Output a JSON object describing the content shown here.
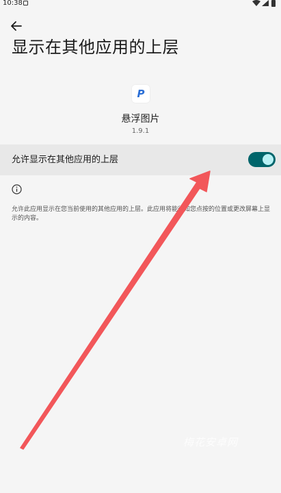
{
  "status_bar": {
    "time": "10:38"
  },
  "header": {
    "back_icon": "arrow-back-icon",
    "title": "显示在其他应用的上层"
  },
  "app": {
    "icon": "app-logo-icon",
    "icon_letter": "P",
    "name": "悬浮图片",
    "version": "1.9.1"
  },
  "permission": {
    "label": "允许显示在其他应用的上层",
    "enabled": true
  },
  "info": {
    "icon": "info-icon",
    "description": "允许此应用显示在您当前使用的其他应用的上层。此应用将能得知您点按的位置或更改屏幕上显示的内容。"
  },
  "watermark": {
    "text": "梅花安卓网"
  },
  "colors": {
    "background": "#f5f5f5",
    "row_background": "#e8e8e8",
    "toggle_track": "#00656b",
    "toggle_knob": "#b8f1f5",
    "annotation_arrow": "#f2575a"
  }
}
